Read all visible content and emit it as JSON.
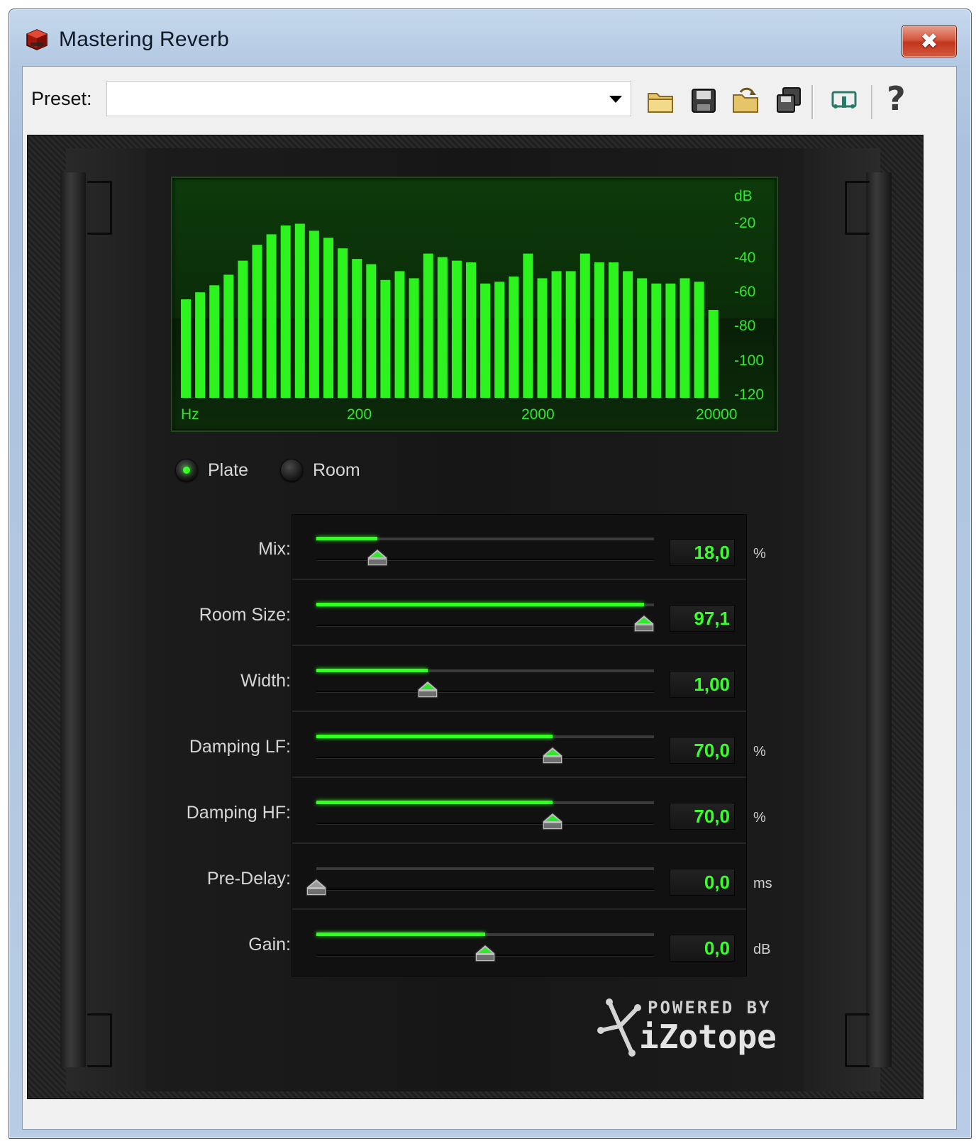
{
  "window": {
    "title": "Mastering Reverb",
    "close_glyph": "✖"
  },
  "toolbar": {
    "preset_label": "Preset:",
    "preset_value": "",
    "help_glyph": "?",
    "icons": [
      "open-folder-icon",
      "save-icon",
      "load-icon",
      "copy-icon",
      "routing-icon",
      "help-icon"
    ]
  },
  "spectrum": {
    "db_unit": "dB",
    "db_ticks": [
      "-20",
      "-40",
      "-60",
      "-80",
      "-100",
      "-120"
    ],
    "hz_unit": "Hz",
    "hz_ticks": [
      "200",
      "2000",
      "20000"
    ],
    "bar_color": "#2cf21e",
    "bar_levels_db": [
      -64,
      -60,
      -56,
      -50,
      -42,
      -33,
      -27,
      -22,
      -21,
      -25,
      -29,
      -35,
      -41,
      -44,
      -53,
      -48,
      -52,
      -38,
      -40,
      -42,
      -43,
      -55,
      -54,
      -51,
      -38,
      -52,
      -48,
      -48,
      -38,
      -43,
      -43,
      -48,
      -52,
      -55,
      -55,
      -52,
      -54,
      -70
    ]
  },
  "mode": {
    "options": [
      {
        "label": "Plate",
        "selected": true
      },
      {
        "label": "Room",
        "selected": false
      }
    ]
  },
  "params": [
    {
      "name": "Mix:",
      "value": "18,0",
      "unit": "%",
      "fraction": 0.18,
      "filled": true
    },
    {
      "name": "Room Size:",
      "value": "97,1",
      "unit": "",
      "fraction": 0.971,
      "filled": true
    },
    {
      "name": "Width:",
      "value": "1,00",
      "unit": "",
      "fraction": 0.33,
      "filled": true
    },
    {
      "name": "Damping LF:",
      "value": "70,0",
      "unit": "%",
      "fraction": 0.7,
      "filled": true
    },
    {
      "name": "Damping HF:",
      "value": "70,0",
      "unit": "%",
      "fraction": 0.7,
      "filled": true
    },
    {
      "name": "Pre-Delay:",
      "value": "0,0",
      "unit": "ms",
      "fraction": 0.0,
      "filled": false
    },
    {
      "name": "Gain:",
      "value": "0,0",
      "unit": "dB",
      "fraction": 0.5,
      "filled": true
    }
  ],
  "logo": {
    "powered": "POWERED BY",
    "brand": "iZotope"
  },
  "colors": {
    "accent_green": "#33ff22",
    "close_red": "#c2351d"
  }
}
